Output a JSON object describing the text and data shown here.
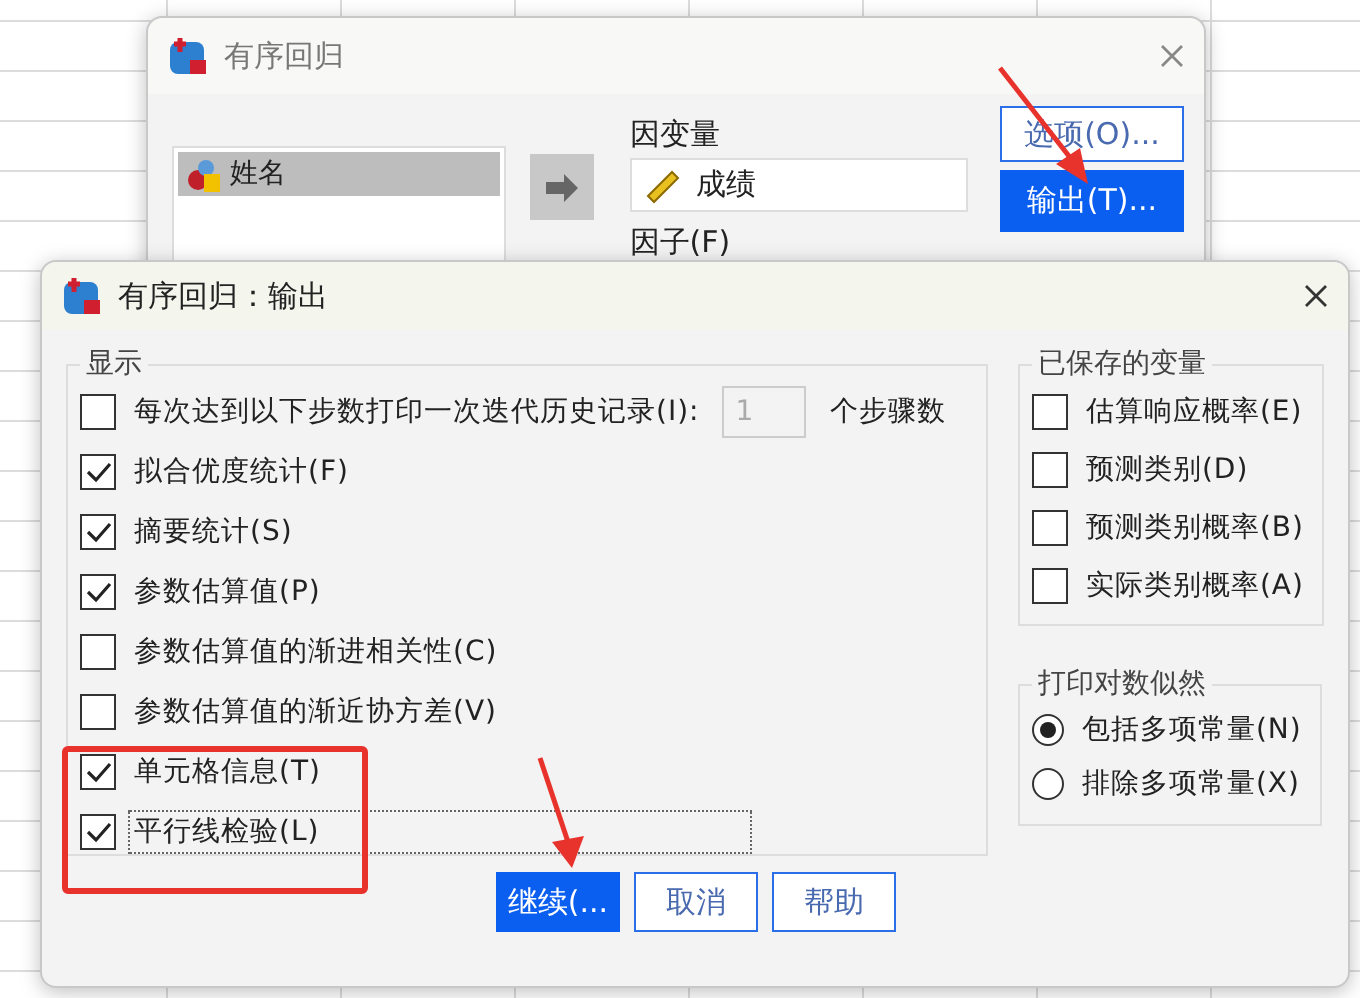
{
  "background_window": {
    "title": "有序回归",
    "variables": [
      {
        "label": "姓名",
        "selected": true
      }
    ],
    "dependent_label": "因变量",
    "dependent_value": "成绩",
    "factor_label": "因子(F)",
    "buttons": [
      {
        "label": "选项(O)...",
        "selected": false
      },
      {
        "label": "输出(T)...",
        "selected": true
      }
    ]
  },
  "dialog": {
    "title": "有序回归：输出",
    "display": {
      "title": "显示",
      "items": [
        {
          "kind": "with-field",
          "label": "每次达到以下步数打印一次迭代历史记录(I):",
          "checked": false,
          "value": "1",
          "field_disabled": true,
          "suffix": "个步骤数"
        },
        {
          "kind": "plain",
          "label": "拟合优度统计(F)",
          "checked": true
        },
        {
          "kind": "plain",
          "label": "摘要统计(S)",
          "checked": true
        },
        {
          "kind": "plain",
          "label": "参数估算值(P)",
          "checked": true
        },
        {
          "kind": "plain",
          "label": "参数估算值的渐进相关性(C)",
          "checked": false
        },
        {
          "kind": "plain",
          "label": "参数估算值的渐近协方差(V)",
          "checked": false
        },
        {
          "kind": "plain",
          "label": "单元格信息(T)",
          "checked": true
        },
        {
          "kind": "plain",
          "label": "平行线检验(L)",
          "checked": true,
          "focused": true
        }
      ]
    },
    "saved": {
      "title": "已保存的变量",
      "items": [
        {
          "label": "估算响应概率(E)",
          "checked": false
        },
        {
          "label": "预测类别(D)",
          "checked": false
        },
        {
          "label": "预测类别概率(B)",
          "checked": false
        },
        {
          "label": "实际类别概率(A)",
          "checked": false
        }
      ]
    },
    "log_likelihood": {
      "title": "打印对数似然",
      "options": [
        {
          "label": "包括多项常量(N)",
          "selected": true
        },
        {
          "label": "排除多项常量(X)",
          "selected": false
        }
      ]
    },
    "buttons": [
      {
        "label": "继续(...",
        "default": true
      },
      {
        "label": "取消",
        "default": false
      },
      {
        "label": "帮助",
        "default": false
      }
    ]
  }
}
